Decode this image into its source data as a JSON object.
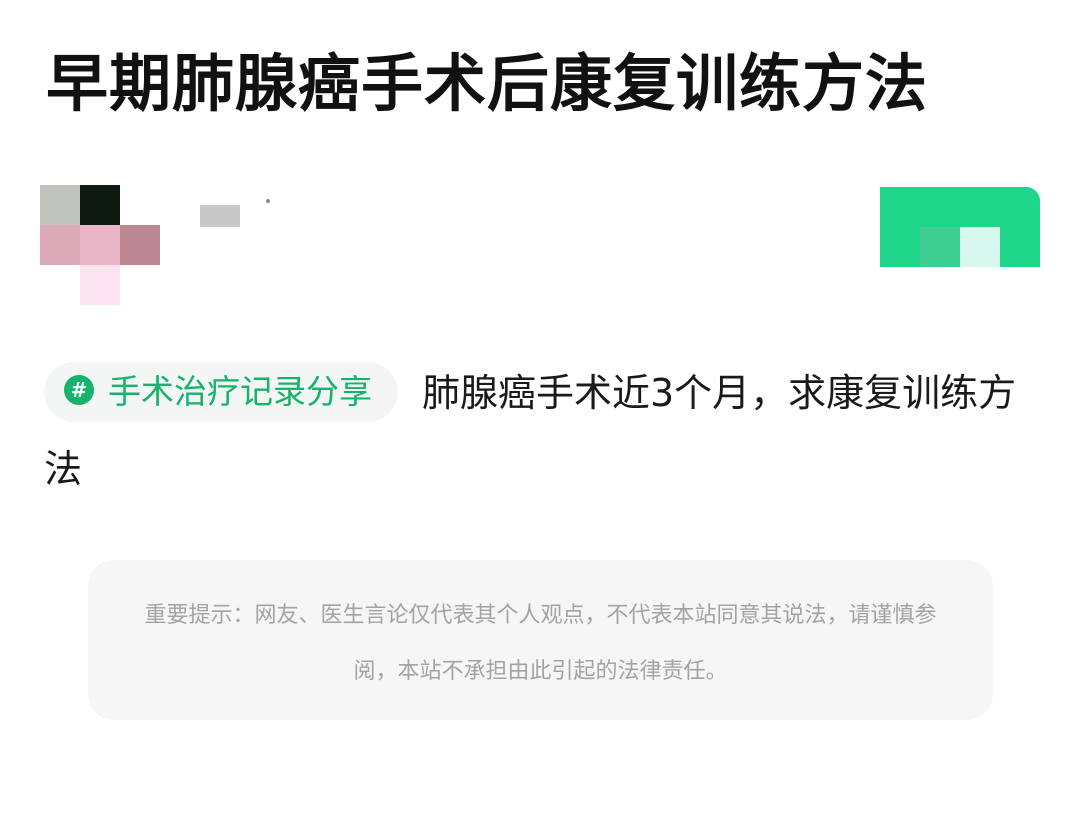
{
  "post": {
    "title": "早期肺腺癌手术后康复训练方法",
    "tag": {
      "icon": "hash-icon",
      "icon_glyph": "#",
      "label": "手术治疗记录分享"
    },
    "body_text": "肺腺癌手术近3个月，求康复训练方法"
  },
  "notice": {
    "text": "重要提示：网友、医生言论仅代表其个人观点，不代表本站同意其说法，请谨慎参阅，本站不承担由此引起的法律责任。"
  },
  "colors": {
    "accent_green": "#16b36c",
    "follow_button": "#1fd68a",
    "notice_bg": "#f6f6f6"
  }
}
